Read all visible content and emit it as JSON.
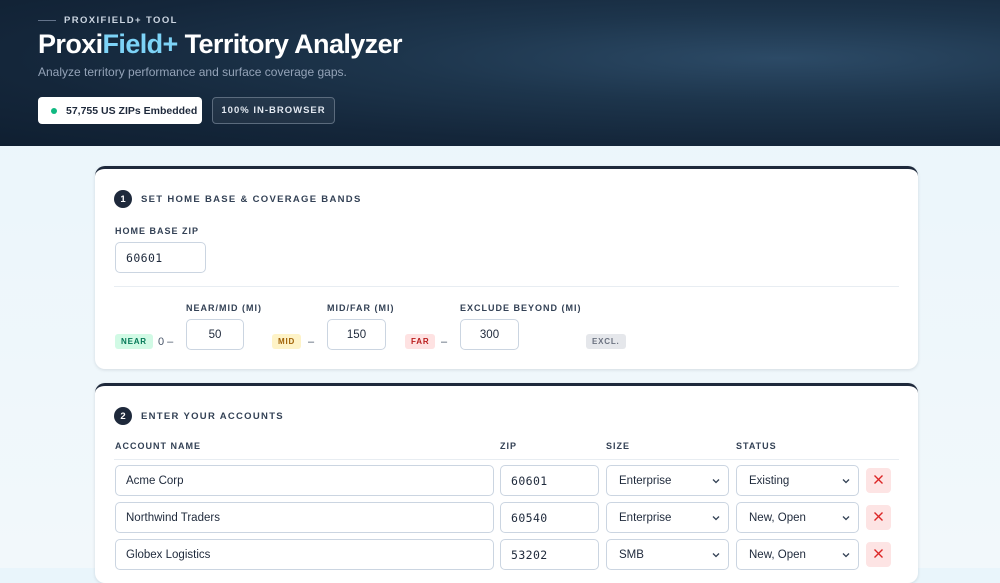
{
  "hero": {
    "eyebrow": "PROXIFIELD+ TOOL",
    "title_part1": "Proxi",
    "title_accent": "Field+",
    "title_part2": " Territory Analyzer",
    "subtitle": "Analyze territory performance and surface coverage gaps.",
    "pill_primary": "57,755 US ZIPs Embedded",
    "pill_secondary": "100% IN-BROWSER"
  },
  "colors": {
    "accent": "#7dd3f7",
    "near": "#047857",
    "mid": "#a16207",
    "far": "#b91c1c",
    "status_dot": "#10b981"
  },
  "section1": {
    "step": "1",
    "heading": "SET HOME BASE & COVERAGE BANDS",
    "home_zip_label": "HOME BASE ZIP",
    "home_zip_value": "60601",
    "near_mid_label": "NEAR/MID (MI)",
    "mid_far_label": "MID/FAR (MI)",
    "exclude_label": "EXCLUDE BEYOND (MI)",
    "near_badge": "NEAR",
    "near_start": "0 –",
    "near_mid_value": "50",
    "mid_badge": "MID",
    "mid_sep": "–",
    "mid_far_value": "150",
    "far_badge": "FAR",
    "far_sep": "–",
    "exclude_value": "300",
    "excl_badge": "EXCL."
  },
  "section2": {
    "step": "2",
    "heading": "ENTER YOUR ACCOUNTS",
    "columns": {
      "name": "ACCOUNT NAME",
      "zip": "ZIP",
      "size": "SIZE",
      "status": "STATUS"
    },
    "rows": [
      {
        "name": "Acme Corp",
        "zip": "60601",
        "size": "Enterprise",
        "status": "Existing"
      },
      {
        "name": "Northwind Traders",
        "zip": "60540",
        "size": "Enterprise",
        "status": "New, Open"
      },
      {
        "name": "Globex Logistics",
        "zip": "53202",
        "size": "SMB",
        "status": "New, Open"
      }
    ]
  },
  "icons": {
    "select_arrow": "chevron-down-icon",
    "remove": "close-icon",
    "status": "status-dot-icon"
  }
}
